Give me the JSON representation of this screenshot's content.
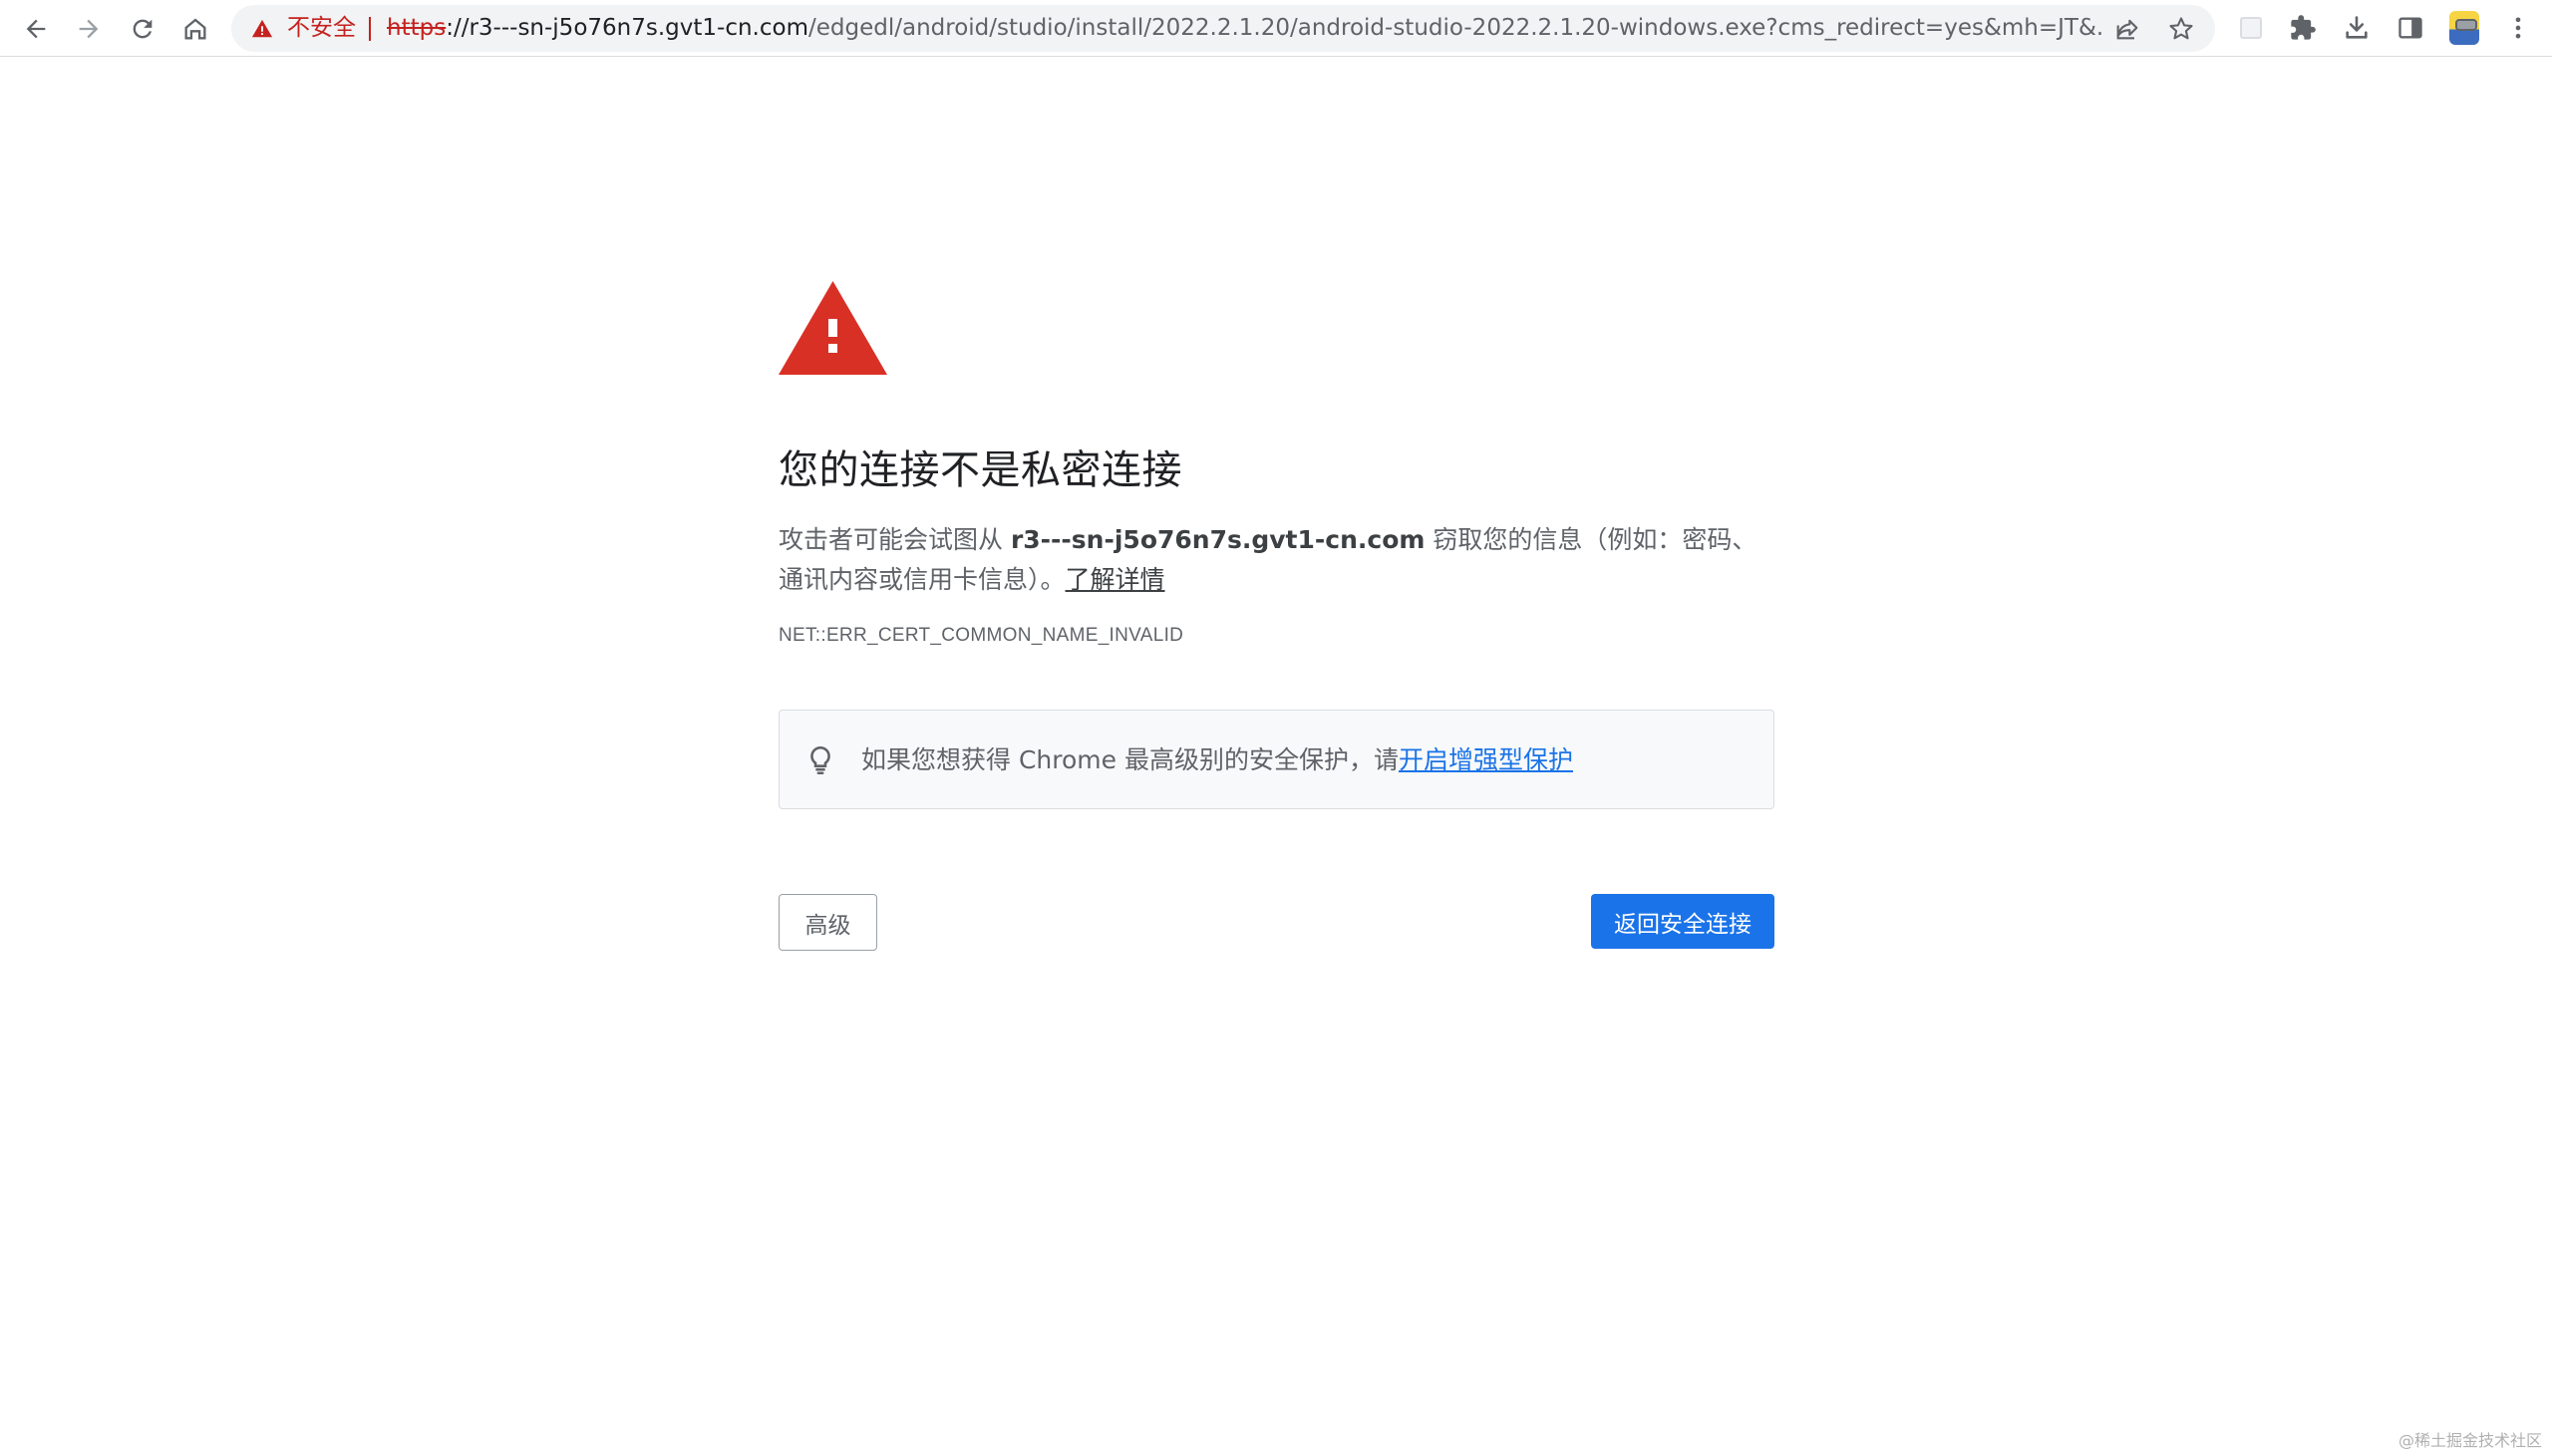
{
  "toolbar": {
    "back_icon": "arrow-left-icon",
    "forward_icon": "arrow-right-icon",
    "reload_icon": "reload-icon",
    "home_icon": "home-icon",
    "omnibox": {
      "security_label": "不安全",
      "url_scheme": "https",
      "url_host_prefix": "://r3---sn-j5o76n7s.gvt1-cn.com",
      "url_path": "/edgedl/android/studio/install/2022.2.1.20/android-studio-2022.2.1.20-windows.exe?cms_redirect=yes&mh=JT&...",
      "share_icon": "share-icon",
      "bookmark_icon": "star-icon"
    },
    "extensions_icon": "puzzle-icon",
    "downloads_icon": "download-icon",
    "side_panel_icon": "side-panel-icon",
    "menu_icon": "more-vert-icon"
  },
  "interstitial": {
    "heading": "您的连接不是私密连接",
    "desc_before": "攻击者可能会试图从 ",
    "desc_host": "r3---sn-j5o76n7s.gvt1-cn.com",
    "desc_after": " 窃取您的信息（例如：密码、通讯内容或信用卡信息）。",
    "learn_more": "了解详情",
    "error_code": "NET::ERR_CERT_COMMON_NAME_INVALID",
    "promo_text": "如果您想获得 Chrome 最高级别的安全保护，请",
    "promo_link": "开启增强型保护",
    "advanced_button": "高级",
    "back_button": "返回安全连接"
  },
  "watermark": "@稀土掘金技术社区",
  "colors": {
    "danger": "#c5221f",
    "warning_triangle": "#d93025",
    "primary": "#1a73e8"
  }
}
